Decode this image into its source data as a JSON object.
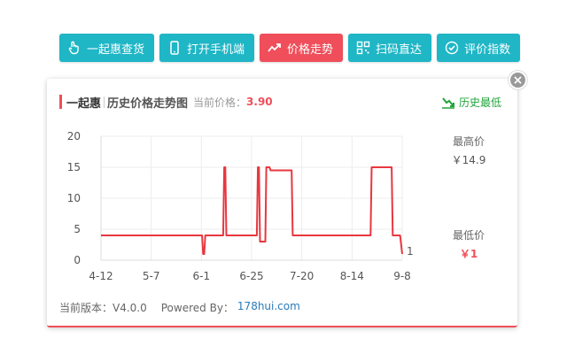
{
  "toolbar": {
    "buttons": [
      {
        "label": "一起惠查货",
        "icon": "hand-pointer-icon"
      },
      {
        "label": "打开手机端",
        "icon": "mobile-phone-icon"
      },
      {
        "label": "价格走势",
        "icon": "trend-chart-icon",
        "active": true
      },
      {
        "label": "扫码直达",
        "icon": "qr-code-icon"
      },
      {
        "label": "评价指数",
        "icon": "check-circle-icon"
      }
    ]
  },
  "panel": {
    "brand": "一起惠",
    "title": "历史价格走势图",
    "current_price_label": "当前价格：",
    "current_price": "3.90",
    "history_low_label": "历史最低",
    "max_label": "最高价",
    "max_value": "￥14.9",
    "min_label": "最低价",
    "min_value": "￥1",
    "footer_version": "当前版本：V4.0.0",
    "footer_powered": "Powered By：",
    "footer_link": "178hui.com"
  },
  "colors": {
    "accent_teal": "#1fb6c6",
    "accent_red": "#ef4e5a",
    "history_low_green": "#21a43b"
  },
  "chart_data": {
    "type": "line",
    "x_tick_labels": [
      "4-12",
      "5-7",
      "6-1",
      "6-25",
      "7-20",
      "8-14",
      "9-8"
    ],
    "y_tick_labels": [
      "20",
      "15",
      "10",
      "5",
      "0"
    ],
    "ylim": [
      0,
      20
    ],
    "grid": true,
    "end_annotation": "1",
    "series": [
      {
        "color": "#e8373f",
        "x": [
          0,
          48,
          48.5,
          49,
          49.5,
          58,
          58.5,
          59,
          59.5,
          74,
          74.5,
          75,
          75.5,
          76,
          76.5,
          78,
          78.5,
          80,
          80.5,
          82,
          82.5,
          90,
          90.5,
          91,
          91.5,
          128,
          128.5,
          131,
          131.5,
          138,
          138.5,
          142,
          143
        ],
        "y": [
          4,
          4,
          1,
          1,
          4,
          4,
          15,
          15,
          4,
          4,
          15,
          15,
          3,
          3,
          3,
          3,
          15,
          15,
          14.5,
          14.5,
          14.5,
          14.5,
          14.5,
          4,
          4,
          4,
          15,
          15,
          15,
          15,
          4,
          4,
          1
        ]
      }
    ]
  }
}
